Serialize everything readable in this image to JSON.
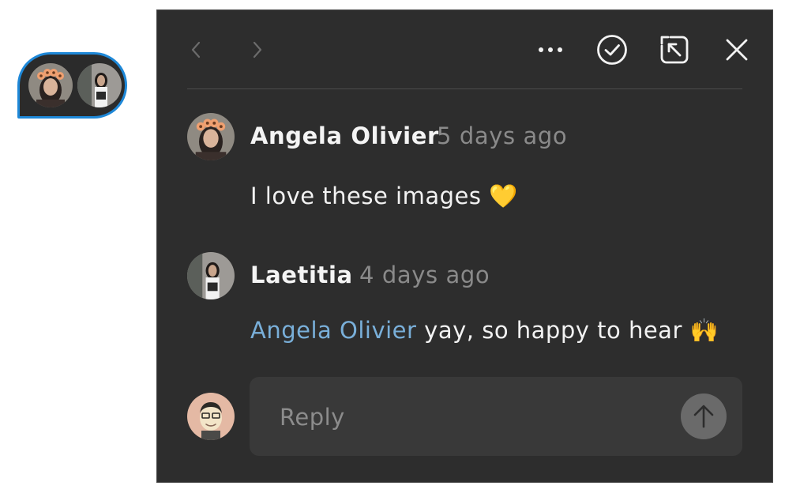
{
  "toolbar": {
    "prev_icon": "chevron-left-icon",
    "next_icon": "chevron-right-icon",
    "more_icon": "more-horizontal-icon",
    "resolve_icon": "check-circle-icon",
    "popout_icon": "arrow-up-left-box-icon",
    "close_icon": "close-icon"
  },
  "comments": [
    {
      "author": "Angela Olivier",
      "time": "5 days ago",
      "text": "I love these images",
      "emoji": "💛"
    },
    {
      "author": "Laetitia",
      "time": "4 days ago",
      "mention": "Angela Olivier",
      "text": "yay, so happy to hear",
      "emoji": "🙌"
    }
  ],
  "reply": {
    "placeholder": "Reply",
    "value": ""
  },
  "colors": {
    "panel_bg": "#2d2d2d",
    "marker_border": "#1e88d8",
    "mention": "#79afd9",
    "muted_text": "#8a8a8a"
  }
}
